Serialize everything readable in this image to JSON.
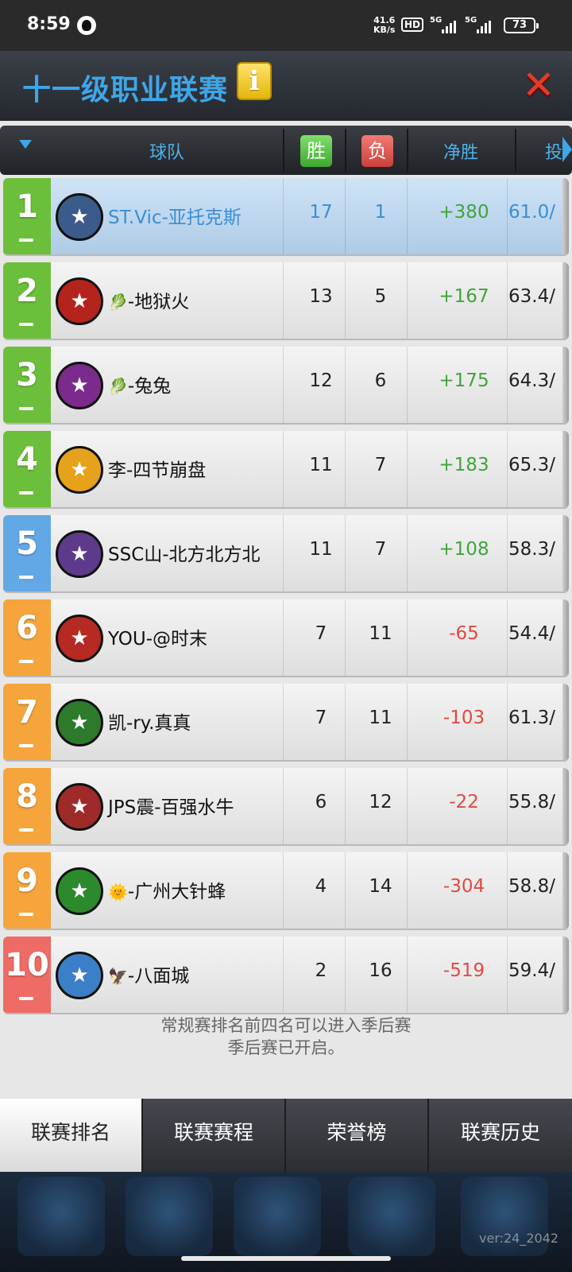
{
  "status_bar": {
    "time": "8:59",
    "net_speed_value": "41.6",
    "net_speed_unit": "KB/s",
    "hd": "HD",
    "sim1": "5G",
    "sim2": "5G",
    "battery": "73"
  },
  "window": {
    "title": "十一级职业联赛",
    "info_label": "i",
    "close_label": "✕"
  },
  "table": {
    "headers": {
      "team": "球队",
      "wins": "胜",
      "losses": "负",
      "net": "净胜",
      "pct": "投"
    },
    "rows": [
      {
        "rank": "1",
        "team": "ST.Vic-亚托克斯",
        "emoji": "",
        "w": "17",
        "l": "1",
        "net": "+380",
        "pct": "61.0/",
        "rank_color": "#6cbf3a",
        "logo_color": "#3b5c8a",
        "logo_icon": "dragon-icon"
      },
      {
        "rank": "2",
        "team": "-地狱火",
        "emoji": "🥬",
        "w": "13",
        "l": "5",
        "net": "+167",
        "pct": "63.4/",
        "rank_color": "#6cbf3a",
        "logo_color": "#b5241c",
        "logo_icon": "flame-icon"
      },
      {
        "rank": "3",
        "team": "-兔兔",
        "emoji": "🥬",
        "w": "12",
        "l": "6",
        "net": "+175",
        "pct": "64.3/",
        "rank_color": "#6cbf3a",
        "logo_color": "#7a2b8c",
        "logo_icon": "purple-creature-icon"
      },
      {
        "rank": "4",
        "team": "李-四节崩盘",
        "emoji": "",
        "w": "11",
        "l": "7",
        "net": "+183",
        "pct": "65.3/",
        "rank_color": "#6cbf3a",
        "logo_color": "#e6a21a",
        "logo_icon": "bird-icon"
      },
      {
        "rank": "5",
        "team": "SSC山-北方北方北",
        "emoji": "",
        "w": "11",
        "l": "7",
        "net": "+108",
        "pct": "58.3/",
        "rank_color": "#62a7e6",
        "logo_color": "#5d3a8a",
        "logo_icon": "owl-icon"
      },
      {
        "rank": "6",
        "team": "YOU-@时末",
        "emoji": "",
        "w": "7",
        "l": "11",
        "net": "-65",
        "pct": "54.4/",
        "rank_color": "#f5a53b",
        "logo_color": "#b52a22",
        "logo_icon": "bull-icon"
      },
      {
        "rank": "7",
        "team": "凯-ry.真真",
        "emoji": "",
        "w": "7",
        "l": "11",
        "net": "-103",
        "pct": "61.3/",
        "rank_color": "#f5a53b",
        "logo_color": "#2d7a2d",
        "logo_icon": "ufo-icon"
      },
      {
        "rank": "8",
        "team": "JPS震-百强水牛",
        "emoji": "",
        "w": "6",
        "l": "12",
        "net": "-22",
        "pct": "55.8/",
        "rank_color": "#f5a53b",
        "logo_color": "#9e2a2a",
        "logo_icon": "buffalo-icon"
      },
      {
        "rank": "9",
        "team": "-广州大针蜂",
        "emoji": "🌞",
        "w": "4",
        "l": "14",
        "net": "-304",
        "pct": "58.8/",
        "rank_color": "#f5a53b",
        "logo_color": "#2c8a2c",
        "logo_icon": "bee-icon"
      },
      {
        "rank": "10",
        "team": "-八面城",
        "emoji": "🦅",
        "w": "2",
        "l": "16",
        "net": "-519",
        "pct": "59.4/",
        "rank_color": "#ee6b66",
        "logo_color": "#3a7fc8",
        "logo_icon": "fox-icon"
      }
    ]
  },
  "footnote": {
    "line1": "常规赛排名前四名可以进入季后赛",
    "line2": "季后赛已开启。"
  },
  "tabs": [
    {
      "label": "联赛排名",
      "active": true
    },
    {
      "label": "联赛赛程",
      "active": false
    },
    {
      "label": "荣誉榜",
      "active": false
    },
    {
      "label": "联赛历史",
      "active": false
    }
  ],
  "version": "ver:24_2042",
  "colors": {
    "title_blue": "#3fa6e8",
    "positive": "#3fa53a",
    "negative": "#e04a43"
  }
}
